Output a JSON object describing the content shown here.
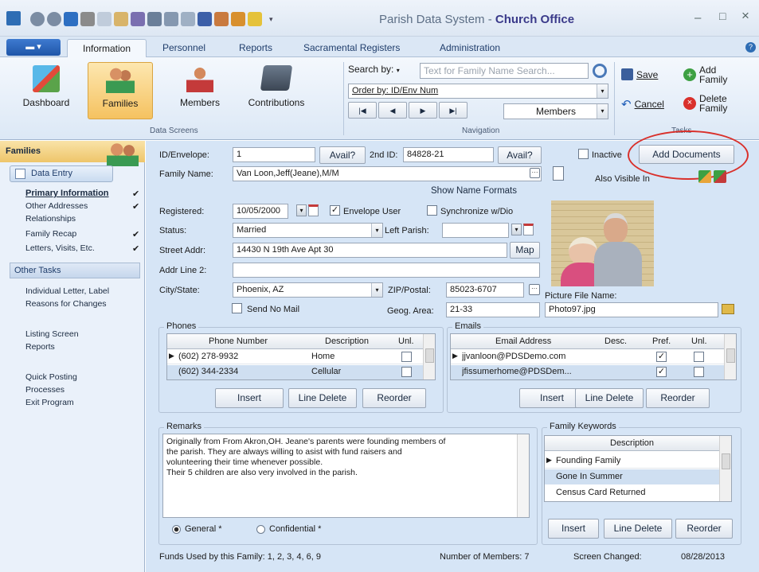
{
  "window": {
    "title_prefix": "Parish Data System - ",
    "title_app": "Church Office",
    "minimize": "–",
    "restore": "□",
    "close": "×"
  },
  "ribbon_tabs": [
    "Information",
    "Personnel",
    "Reports",
    "Sacramental Registers",
    "Administration"
  ],
  "data_screens": {
    "group_label": "Data Screens",
    "items": [
      "Dashboard",
      "Families",
      "Members",
      "Contributions"
    ]
  },
  "navigation": {
    "group_label": "Navigation",
    "search_by": "Search by:",
    "search_placeholder": "Text for Family Name Search...",
    "order_by": "Order by: ID/Env Num",
    "members_select": "Members",
    "nav_first": "|◀",
    "nav_prev": "◀",
    "nav_next": "▶",
    "nav_last": "▶|"
  },
  "tasks": {
    "group_label": "Tasks",
    "save": "Save",
    "cancel": "Cancel",
    "add_family": "Add Family",
    "delete_family": "Delete Family"
  },
  "sidebar": {
    "header": "Families",
    "data_entry": "Data Entry",
    "items": [
      {
        "label": "Primary Information",
        "check": "✔"
      },
      {
        "label": "Other Addresses",
        "check": "✔"
      },
      {
        "label": "Relationships",
        "check": ""
      },
      {
        "label": "Family Recap",
        "check": "✔"
      },
      {
        "label": "Letters, Visits, Etc.",
        "check": "✔"
      }
    ],
    "other_tasks": "Other Tasks",
    "tasks": [
      "Individual Letter, Label",
      "Reasons for Changes",
      "Listing Screen",
      "Reports",
      "Quick Posting",
      "Processes",
      "Exit Program"
    ]
  },
  "form": {
    "id_label": "ID/Envelope:",
    "id_value": "1",
    "avail1": "Avail?",
    "id2_label": "2nd ID:",
    "id2_value": "84828-21",
    "avail2": "Avail?",
    "inactive_label": "Inactive",
    "add_documents": "Add Documents",
    "also_visible": "Also Visible In",
    "family_name_label": "Family Name:",
    "family_name_value": "Van Loon,Jeff(Jeane),M/M",
    "show_name_formats": "Show Name Formats",
    "registered_label": "Registered:",
    "registered_value": "10/05/2000",
    "envelope_user": "Envelope User",
    "envelope_check": "✓",
    "synchronize": "Synchronize w/Dio",
    "status_label": "Status:",
    "status_value": "Married",
    "left_parish_label": "Left Parish:",
    "street_label": "Street Addr:",
    "street_value": "14430 N 19th Ave Apt 30",
    "map_button": "Map",
    "addr2_label": "Addr Line 2:",
    "city_label": "City/State:",
    "city_value": "Phoenix, AZ",
    "zip_label": "ZIP/Postal:",
    "zip_value": "85023-6707",
    "send_no_mail": "Send No Mail",
    "geog_label": "Geog. Area:",
    "geog_value": "21-33",
    "picture_label": "Picture File Name:",
    "picture_value": "Photo97.jpg"
  },
  "phones": {
    "title": "Phones",
    "headers": [
      "Phone Number",
      "Description",
      "Unl."
    ],
    "rows": [
      {
        "number": "(602) 278-9932",
        "desc": "Home",
        "unl": ""
      },
      {
        "number": "(602) 344-2334",
        "desc": "Cellular",
        "unl": ""
      }
    ],
    "insert": "Insert",
    "line_delete": "Line Delete",
    "reorder": "Reorder"
  },
  "emails": {
    "title": "Emails",
    "headers": [
      "Email Address",
      "Desc.",
      "Pref.",
      "Unl."
    ],
    "rows": [
      {
        "email": "jjvanloon@PDSDemo.com",
        "desc": "",
        "pref": "✓",
        "unl": ""
      },
      {
        "email": "jfissumerhome@PDSDem...",
        "desc": "",
        "pref": "✓",
        "unl": ""
      }
    ],
    "insert": "Insert",
    "line_delete": "Line Delete",
    "reorder": "Reorder"
  },
  "remarks": {
    "title": "Remarks",
    "lines": [
      "Originally from From Akron,OH.  Jeane's parents were founding members of",
      "the parish.  They are always willing to asist with fund raisers and",
      "volunteering their time whenever possible.",
      "Their 5 children are also very involved in the parish."
    ],
    "general": "General *",
    "confidential": "Confidential *"
  },
  "keywords": {
    "title": "Family Keywords",
    "header": "Description",
    "rows": [
      "Founding Family",
      "Gone In Summer",
      "Census Card Returned"
    ],
    "insert": "Insert",
    "line_delete": "Line Delete",
    "reorder": "Reorder"
  },
  "status_bar": {
    "funds": "Funds Used by this Family:  1, 2, 3, 4, 6, 9",
    "members": "Number of Members: 7",
    "changed_label": "Screen Changed:",
    "changed_value": "08/28/2013"
  },
  "colors": {
    "accent_orange": "#f5c260",
    "highlight_circle": "#d9302b",
    "panel_blue": "#d6e5f6",
    "ribbon_blue": "#dbe7f5",
    "title_app": "#3a3a8a"
  }
}
